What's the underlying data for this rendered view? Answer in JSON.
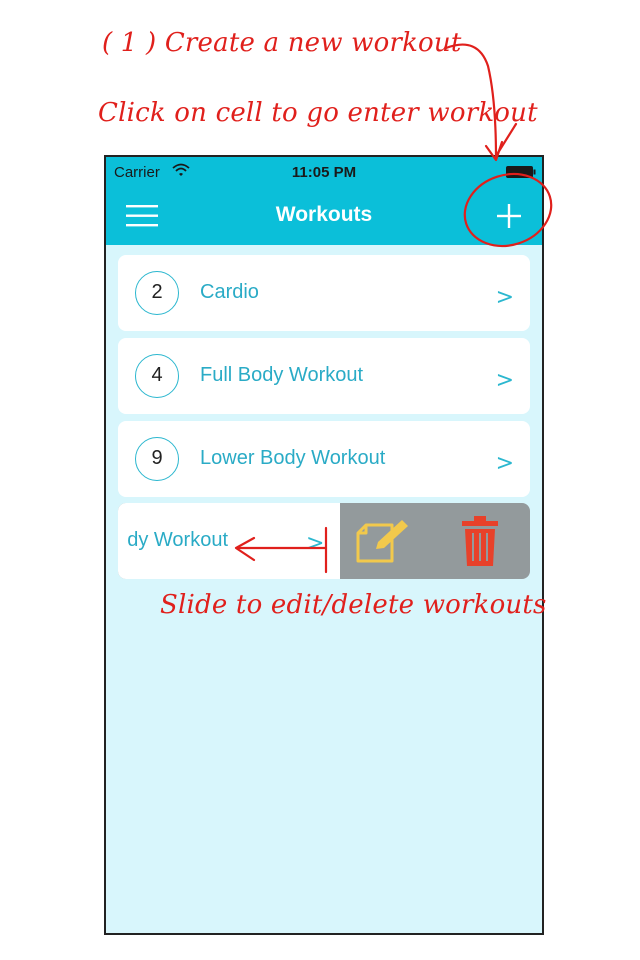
{
  "annotations": {
    "create": "( 1 ) Create a new workout",
    "click_cell": "Click on cell to go enter workout",
    "slide": "Slide to edit/delete workouts"
  },
  "status_bar": {
    "carrier": "Carrier",
    "time": "11:05 PM"
  },
  "nav": {
    "title": "Workouts"
  },
  "workouts": [
    {
      "count": "2",
      "name": "Cardio",
      "chevron": ">"
    },
    {
      "count": "4",
      "name": "Full Body Workout",
      "chevron": ">"
    },
    {
      "count": "9",
      "name": "Lower Body Workout",
      "chevron": ">"
    }
  ],
  "swiped_workout": {
    "name": "dy Workout",
    "chevron": ">"
  },
  "icons": {
    "menu": "hamburger-menu-icon",
    "add": "plus-icon",
    "edit": "edit-note-icon",
    "delete": "trash-icon"
  },
  "colors": {
    "accent": "#0bbfd9",
    "background": "#d8f6fc",
    "annotation": "#e0201c",
    "edit_icon": "#f2c94c",
    "delete_icon": "#e8412a",
    "swipe_actions_bg": "#939a9c"
  }
}
